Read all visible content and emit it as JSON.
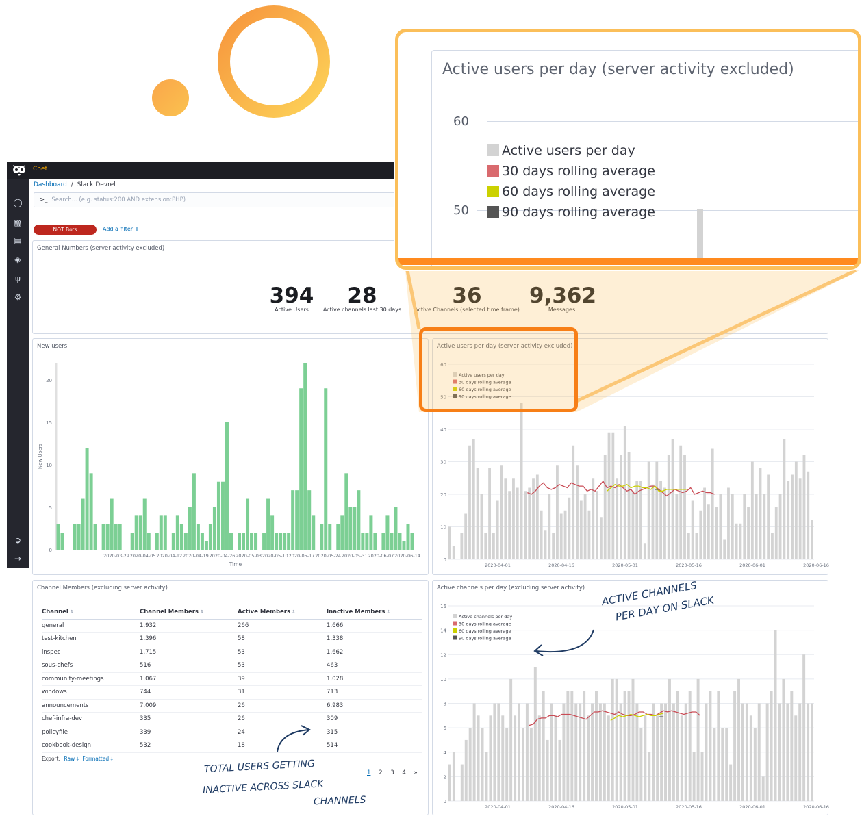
{
  "app": {
    "name": "Chef"
  },
  "breadcrumb": {
    "root": "Dashboard",
    "separator": "/",
    "current": "Slack Devrel"
  },
  "search": {
    "prompt": ">_",
    "placeholder": "Search... (e.g. status:200 AND extension:PHP)"
  },
  "filters": {
    "pill": "NOT Bots",
    "add": "Add a filter"
  },
  "sidebar": {
    "icons": [
      "compass-icon",
      "chart-icon",
      "dashboard-icon",
      "shield-icon",
      "wrench-icon",
      "gear-icon",
      "logout-icon",
      "arrow-right-icon"
    ]
  },
  "general": {
    "title": "General Numbers (server activity excluded)",
    "metrics": [
      {
        "value": "394",
        "label": "Active Users"
      },
      {
        "value": "28",
        "label": "Active channels last 30 days"
      },
      {
        "value": "36",
        "label": "Active Channels (selected time frame)"
      },
      {
        "value": "9,362",
        "label": "Messages"
      }
    ]
  },
  "new_users": {
    "title": "New users",
    "ylabel": "New Users",
    "xlabel": "Time"
  },
  "active_users": {
    "title": "Active users per day (server activity excluded)"
  },
  "active_channels": {
    "title": "Active channels per day (excluding server activity)"
  },
  "channels_table": {
    "title": "Channel Members (excluding server activity)",
    "headers": [
      "Channel",
      "Channel Members",
      "Active Members",
      "Inactive Members"
    ],
    "rows": [
      [
        "general",
        "1,932",
        "266",
        "1,666"
      ],
      [
        "test-kitchen",
        "1,396",
        "58",
        "1,338"
      ],
      [
        "inspec",
        "1,715",
        "53",
        "1,662"
      ],
      [
        "sous-chefs",
        "516",
        "53",
        "463"
      ],
      [
        "community-meetings",
        "1,067",
        "39",
        "1,028"
      ],
      [
        "windows",
        "744",
        "31",
        "713"
      ],
      [
        "announcements",
        "7,009",
        "26",
        "6,983"
      ],
      [
        "chef-infra-dev",
        "335",
        "26",
        "309"
      ],
      [
        "policyfile",
        "339",
        "24",
        "315"
      ],
      [
        "cookbook-design",
        "532",
        "18",
        "514"
      ]
    ],
    "export_label": "Export:",
    "export_raw": "Raw",
    "export_formatted": "Formatted",
    "pages": [
      "1",
      "2",
      "3",
      "4",
      "»"
    ]
  },
  "callout": {
    "title": "Active users per day (server activity excluded)",
    "ticks": [
      "60",
      "50"
    ],
    "legend": [
      "Active users per day",
      "30 days rolling average",
      "60 days rolling average",
      "90 days rolling average"
    ]
  },
  "annotations": {
    "channels_note_1": "ACTIVE CHANNELS",
    "channels_note_2": "PER DAY ON SLACK",
    "inactive_note_1": "TOTAL USERS GETTING",
    "inactive_note_2": "INACTIVE ACROSS SLACK",
    "inactive_note_3": "CHANNELS"
  },
  "colors": {
    "bar_green": "#7ccf94",
    "bar_grey": "#d3d3d3",
    "avg30": "#c94b55",
    "avg60": "#cbd100",
    "avg90": "#555555",
    "callout_orange": "#f77f17"
  },
  "chart_data": [
    {
      "type": "bar",
      "title": "New users",
      "xlabel": "Time",
      "ylabel": "New Users",
      "ylim": [
        0,
        22
      ],
      "yticks": [
        0,
        5,
        10,
        15,
        20
      ],
      "xticks": [
        "2020-03-29",
        "2020-04-05",
        "2020-04-12",
        "2020-04-19",
        "2020-04-26",
        "2020-05-03",
        "2020-05-10",
        "2020-05-17",
        "2020-05-24",
        "2020-05-31",
        "2020-06-07",
        "2020-06-14"
      ],
      "series": [
        {
          "values": [
            3,
            2,
            0,
            0,
            3,
            3,
            6,
            12,
            9,
            3,
            0,
            3,
            3,
            6,
            3,
            3,
            0,
            0,
            2,
            4,
            4,
            6,
            2,
            0,
            2,
            4,
            4,
            0,
            2,
            4,
            3,
            2,
            5,
            9,
            3,
            2,
            1,
            3,
            5,
            8,
            8,
            15,
            2,
            0,
            2,
            2,
            6,
            2,
            2,
            0,
            2,
            6,
            4,
            2,
            2,
            2,
            2,
            7,
            7,
            19,
            22,
            7,
            4,
            0,
            3,
            19,
            3,
            0,
            3,
            4,
            9,
            5,
            5,
            7,
            2,
            2,
            4,
            2,
            0,
            2,
            4,
            2,
            5,
            2,
            1,
            3,
            2
          ]
        }
      ]
    },
    {
      "type": "bar",
      "title": "Active users per day (server activity excluded)",
      "ylim": [
        0,
        60
      ],
      "yticks": [
        0,
        10,
        20,
        30,
        40,
        50,
        60
      ],
      "xticks": [
        "2020-04-01",
        "2020-04-16",
        "2020-05-01",
        "2020-05-16",
        "2020-06-01",
        "2020-06-16"
      ],
      "legend": [
        "Active users per day",
        "30 days rolling average",
        "60 days rolling average",
        "90 days rolling average"
      ],
      "series": [
        {
          "name": "Active users per day",
          "values": [
            10,
            4,
            0,
            8,
            14,
            35,
            37,
            28,
            20,
            8,
            28,
            8,
            18,
            29,
            25,
            21,
            25,
            22,
            48,
            21,
            22,
            25,
            26,
            15,
            9,
            20,
            8,
            29,
            14,
            15,
            19,
            35,
            29,
            18,
            20,
            15,
            25,
            21,
            13,
            32,
            39,
            39,
            25,
            32,
            41,
            33,
            21,
            24,
            24,
            5,
            30,
            23,
            30,
            24,
            22,
            32,
            37,
            20,
            35,
            32,
            8,
            18,
            8,
            15,
            22,
            17,
            34,
            16,
            20,
            6,
            22,
            20,
            11,
            11,
            20,
            16,
            30,
            20,
            28,
            20,
            26,
            8,
            16,
            20,
            37,
            24,
            26,
            30,
            25,
            32,
            27,
            12
          ]
        },
        {
          "name": "30 days rolling average",
          "values": [
            20.5,
            20,
            21,
            22.5,
            23.5,
            22,
            21.5,
            22,
            23,
            22.5,
            22,
            23.5,
            23,
            22.5,
            22.5,
            21,
            21.5,
            21,
            22.5,
            24,
            22,
            22.5,
            22,
            23,
            22,
            21,
            21.5,
            20,
            21,
            21.5,
            22,
            22.5,
            22.5,
            21.5,
            20.5,
            19.5,
            20.5,
            21.5,
            21,
            20.5,
            21,
            22,
            20,
            20.5,
            21,
            20.5,
            20.5,
            20
          ]
        },
        {
          "name": "60 days rolling average",
          "values": [
            21,
            22,
            23,
            22.5,
            22.5,
            23,
            22,
            22.5,
            22.5,
            22,
            22,
            21.5,
            22.5,
            21,
            21,
            21.5,
            21.5,
            21.5,
            21.5,
            21.5,
            21.5
          ]
        },
        {
          "name": "90 days rolling average",
          "values": [
            21.5,
            21.5
          ]
        }
      ]
    },
    {
      "type": "bar",
      "title": "Active channels per day (excluding server activity)",
      "ylim": [
        0,
        16
      ],
      "yticks": [
        0,
        2,
        4,
        6,
        8,
        10,
        12,
        14,
        16
      ],
      "xticks": [
        "2020-04-01",
        "2020-04-16",
        "2020-05-01",
        "2020-05-16",
        "2020-06-01",
        "2020-06-16"
      ],
      "legend": [
        "Active channels per day",
        "30 days rolling average",
        "60 days rolling average",
        "90 days rolling average"
      ],
      "series": [
        {
          "name": "Active channels per day",
          "values": [
            3,
            4,
            0,
            3,
            5,
            6,
            8,
            7,
            6,
            4,
            7,
            8,
            8,
            7,
            6,
            10,
            7,
            8,
            6,
            8,
            6,
            11,
            7,
            9,
            5,
            8,
            7,
            5,
            8,
            9,
            9,
            8,
            8,
            9,
            7,
            8,
            9,
            8,
            8,
            7,
            10,
            10,
            8,
            9,
            9,
            10,
            8,
            6,
            7,
            4,
            8,
            7,
            8,
            8,
            10,
            8,
            9,
            7,
            8,
            9,
            4,
            10,
            4,
            8,
            9,
            6,
            9,
            6,
            6,
            3,
            9,
            10,
            8,
            8,
            7,
            6,
            8,
            2,
            8,
            9,
            14,
            8,
            10,
            8,
            9,
            7,
            8,
            12,
            8,
            8
          ]
        },
        {
          "name": "30 days rolling average",
          "values": [
            6.2,
            6.3,
            6.7,
            6.8,
            6.8,
            7,
            7,
            6.9,
            7.1,
            7.1,
            7.1,
            7,
            6.9,
            6.8,
            6.7,
            7,
            7.3,
            7.3,
            7.4,
            7.3,
            7.2,
            7.1,
            7.3,
            7.1,
            7,
            7,
            7.1,
            7.3,
            7.3,
            7.1,
            7.1,
            7,
            7.2,
            7.4,
            7.3,
            7.4,
            7.3,
            7.2,
            7.1,
            7.2,
            7.3,
            7.3,
            7
          ]
        },
        {
          "name": "60 days rolling average",
          "values": [
            6.6,
            6.8,
            7,
            6.9,
            7,
            7.1,
            7,
            6.9,
            7,
            7.1,
            7,
            7,
            7.1,
            7.2
          ]
        },
        {
          "name": "90 days rolling average",
          "values": [
            6.9,
            6.9
          ]
        }
      ]
    }
  ]
}
